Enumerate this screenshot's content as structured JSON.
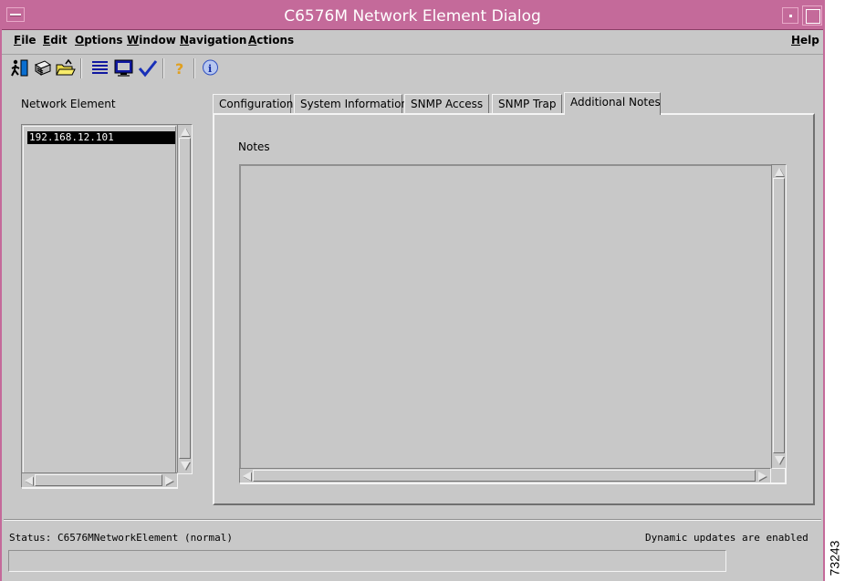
{
  "window": {
    "title": "C6576M Network Element Dialog",
    "title_bar_color": "#c46a9a",
    "background_color": "#c8c8c8"
  },
  "menubar": {
    "items": [
      {
        "label": "File",
        "mnemonic": "F"
      },
      {
        "label": "Edit",
        "mnemonic": "E"
      },
      {
        "label": "Options",
        "mnemonic": "O"
      },
      {
        "label": "Window",
        "mnemonic": "W"
      },
      {
        "label": "Navigation",
        "mnemonic": "N"
      },
      {
        "label": "Actions",
        "mnemonic": "A"
      }
    ],
    "help": {
      "label": "Help",
      "mnemonic": "H"
    }
  },
  "toolbar": {
    "icons": [
      "exit-icon",
      "print-icon",
      "open-folder-icon",
      "list-icon",
      "monitor-icon",
      "checkmark-icon",
      "help-question-icon",
      "info-icon"
    ]
  },
  "network_element": {
    "label": "Network Element",
    "items": [
      "192.168.12.101"
    ],
    "selected_index": 0
  },
  "tabs": [
    {
      "label": "Configuration",
      "active": false
    },
    {
      "label": "System Information",
      "active": false
    },
    {
      "label": "SNMP Access",
      "active": false
    },
    {
      "label": "SNMP Trap",
      "active": false
    },
    {
      "label": "Additional Notes",
      "active": true
    }
  ],
  "notes": {
    "label": "Notes",
    "value": ""
  },
  "status": {
    "text": "Status: C6576MNetworkElement (normal)",
    "updates": "Dynamic updates are enabled"
  },
  "figure_id": "73243"
}
